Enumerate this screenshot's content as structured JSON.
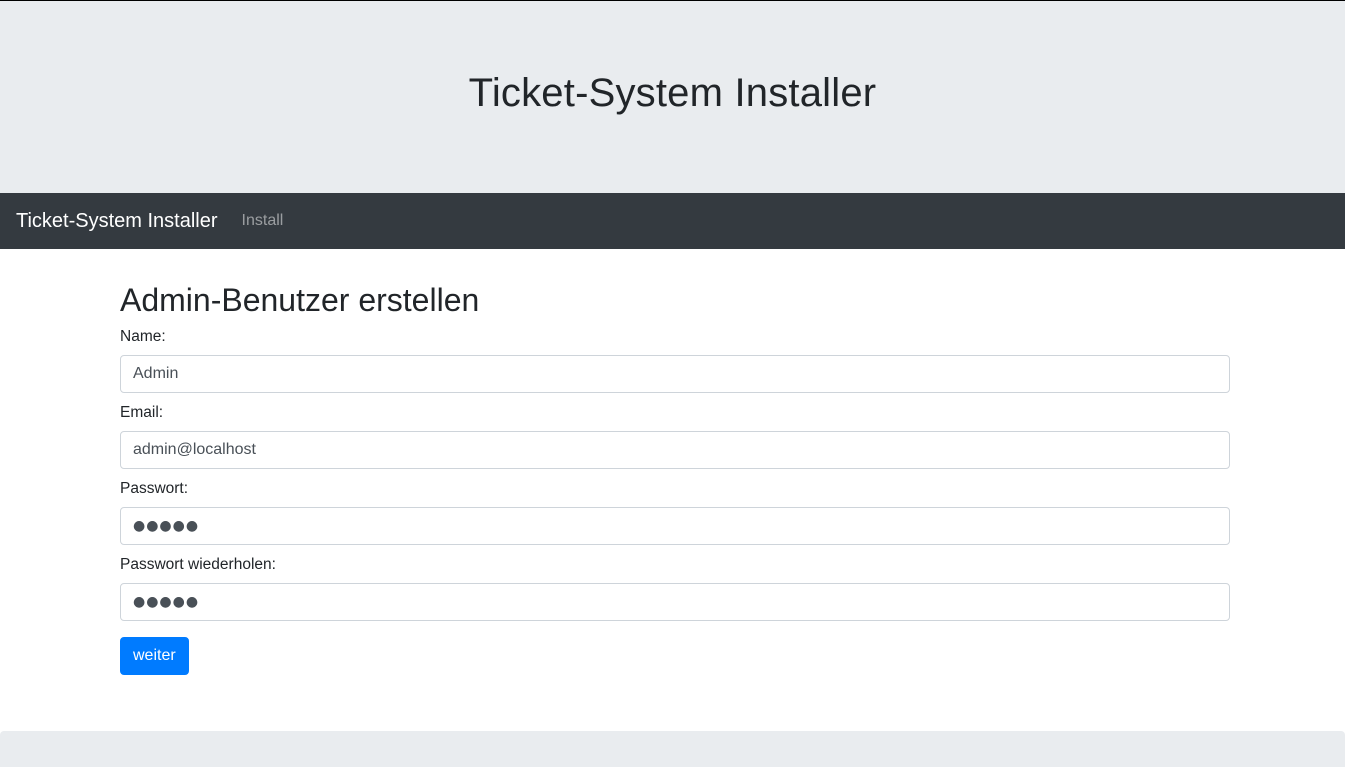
{
  "header": {
    "title": "Ticket-System Installer"
  },
  "navbar": {
    "brand": "Ticket-System Installer",
    "links": [
      "Install"
    ]
  },
  "form": {
    "heading": "Admin-Benutzer erstellen",
    "name_label": "Name:",
    "name_value": "Admin",
    "email_label": "Email:",
    "email_value": "admin@localhost",
    "password_label": "Passwort:",
    "password_value": "●●●●●",
    "password_repeat_label": "Passwort wiederholen:",
    "password_repeat_value": "●●●●●",
    "submit_label": "weiter"
  },
  "colors": {
    "jumbotron_bg": "#e9ecef",
    "navbar_bg": "#343a40",
    "primary": "#007bff"
  }
}
